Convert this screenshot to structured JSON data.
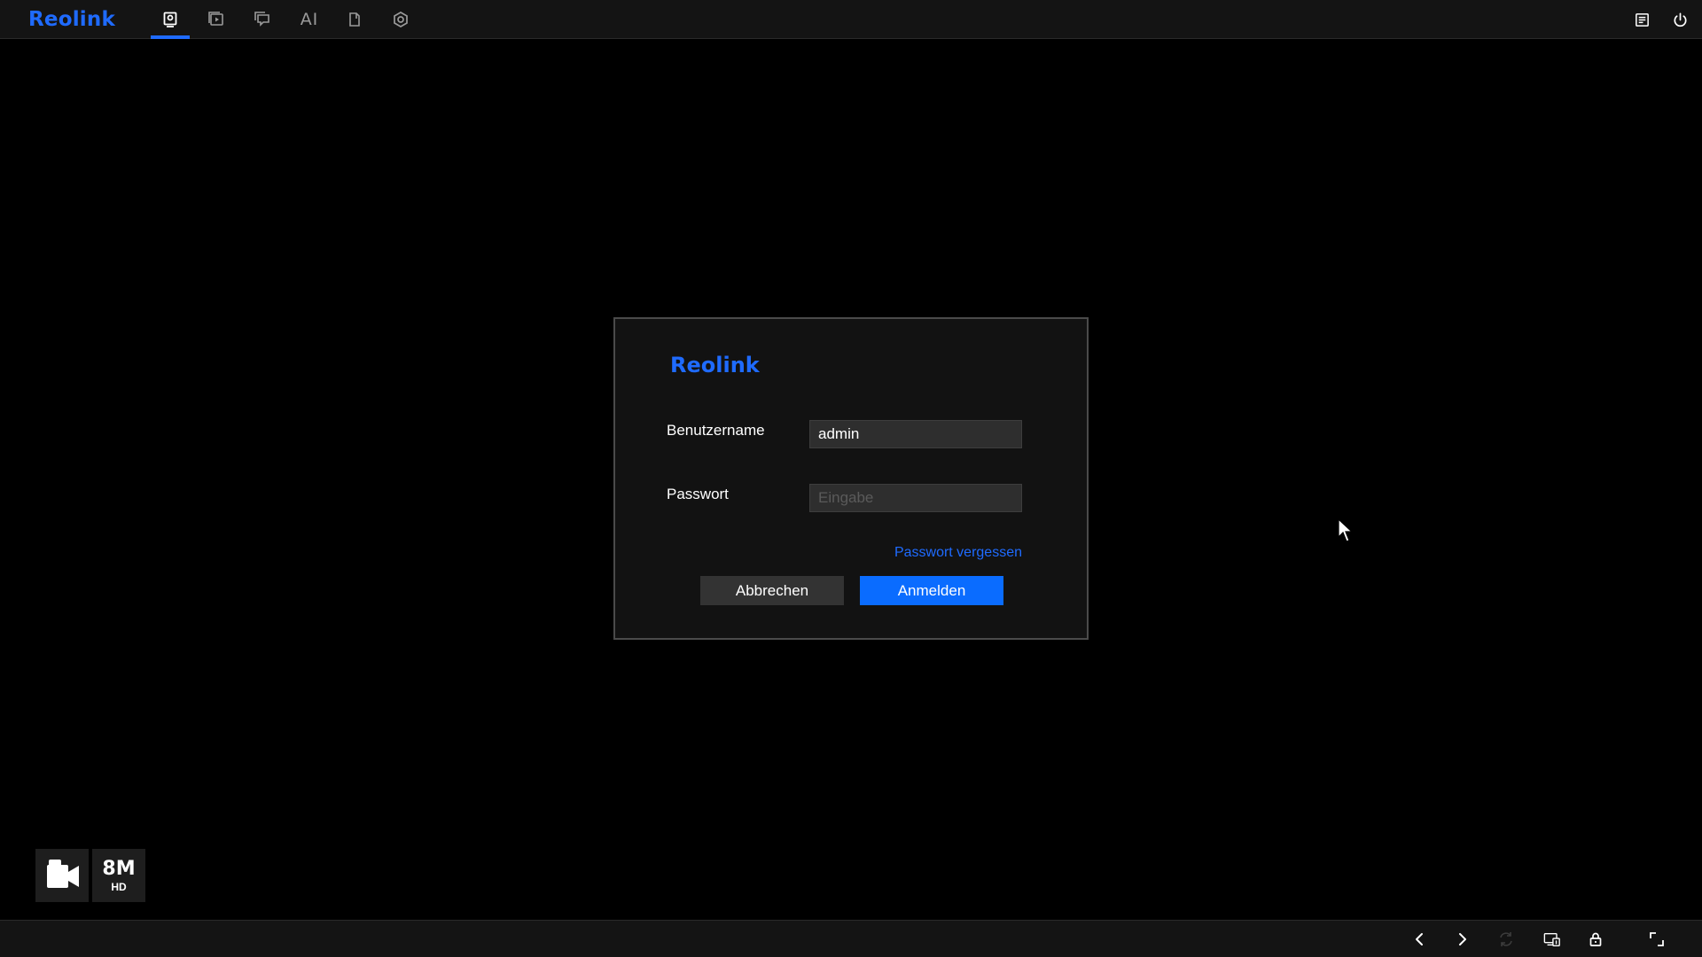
{
  "app": {
    "brand": "Reolink",
    "accent_color": "#1f6bff"
  },
  "topbar": {
    "nav": [
      {
        "icon": "live-view-icon",
        "active": true
      },
      {
        "icon": "playback-icon",
        "active": false
      },
      {
        "icon": "messages-icon",
        "active": false
      },
      {
        "icon": "ai-icon",
        "label": "AI",
        "active": false
      },
      {
        "icon": "file-search-icon",
        "active": false
      },
      {
        "icon": "settings-icon",
        "active": false
      }
    ],
    "right_icons": [
      "notes-icon",
      "power-icon"
    ]
  },
  "login": {
    "logo": "Reolink",
    "username_label": "Benutzername",
    "username_value": "admin",
    "password_label": "Passwort",
    "password_placeholder": "Eingabe",
    "forgot_label": "Passwort vergessen",
    "cancel_label": "Abbrechen",
    "login_label": "Anmelden"
  },
  "badges": {
    "camera_icon": "video-camera-icon",
    "resolution": "8M",
    "resolution_sub": "HD"
  },
  "bottombar": {
    "icons": [
      "chevron-left-icon",
      "chevron-right-icon",
      "swap-icon",
      "screen-layout-icon",
      "lock-icon",
      "fullscreen-icon"
    ]
  }
}
